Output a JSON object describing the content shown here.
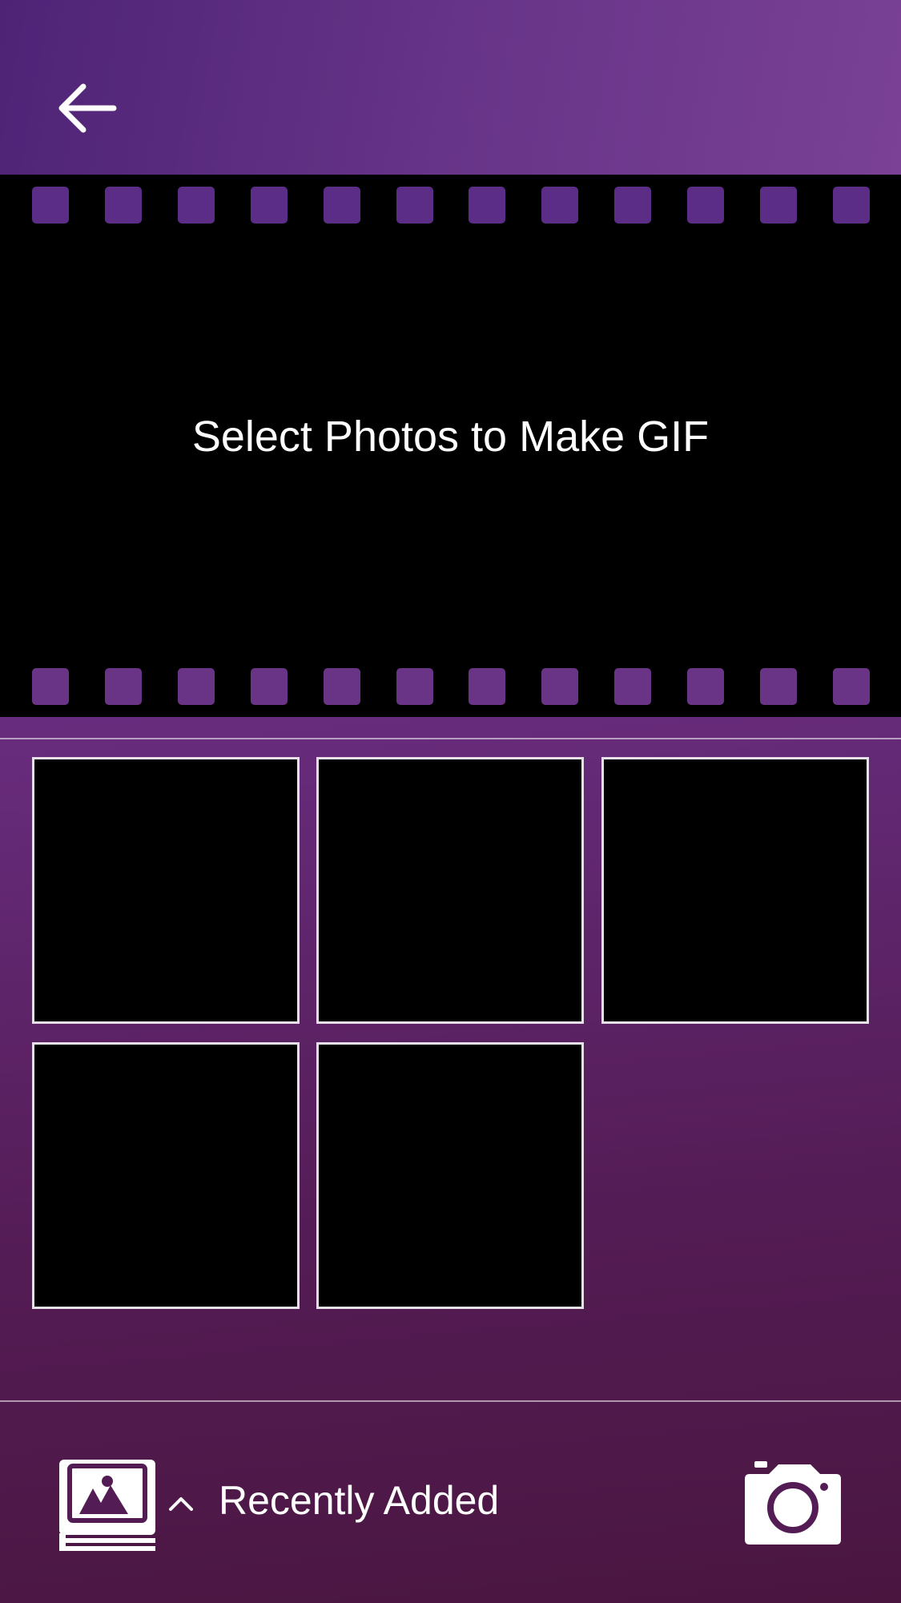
{
  "header": {
    "back_icon": "arrow-left-icon"
  },
  "filmstrip": {
    "title": "Select Photos to Make GIF",
    "sprocket_color_top": "#5b2d86",
    "sprocket_color_bottom": "#6a3486"
  },
  "selection_grid": {
    "slots": [
      {
        "state": "empty"
      },
      {
        "state": "empty"
      },
      {
        "state": "empty"
      },
      {
        "state": "empty"
      },
      {
        "state": "empty"
      }
    ]
  },
  "bottom_bar": {
    "album_icon": "photo-album-icon",
    "caret_icon": "chevron-up-icon",
    "album_label": "Recently Added",
    "camera_icon": "camera-icon"
  },
  "colors": {
    "header_start": "#4e2376",
    "header_end": "#7a4196",
    "background_bottom": "#4a1640",
    "slot_border": "#e6e0e8"
  }
}
